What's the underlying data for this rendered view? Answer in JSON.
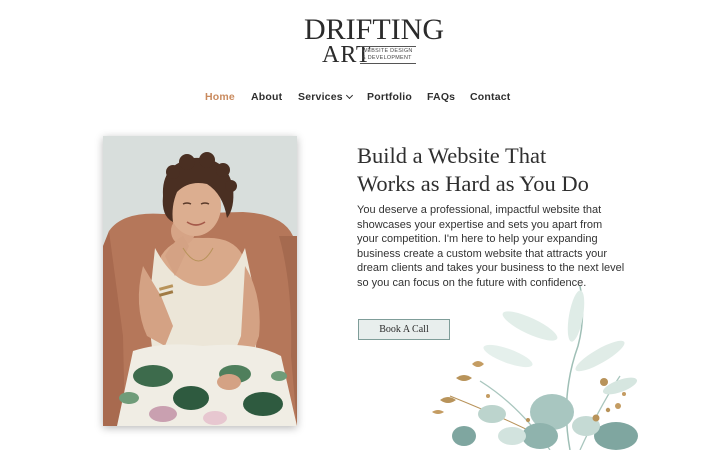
{
  "logo": {
    "word1": "DRIFTING",
    "word2": "ART",
    "tagline_line1": "WEBSITE DESIGN",
    "tagline_line2": "& DEVELOPMENT"
  },
  "nav": {
    "items": [
      {
        "label": "Home",
        "active": true
      },
      {
        "label": "About",
        "active": false
      },
      {
        "label": "Services",
        "active": false
      },
      {
        "label": "Portfolio",
        "active": false
      },
      {
        "label": "FAQs",
        "active": false
      },
      {
        "label": "Contact",
        "active": false
      }
    ]
  },
  "hero": {
    "headline_line1": "Build a Website That",
    "headline_line2": "Works as Hard as You Do",
    "body": "You deserve a professional, impactful website that showcases your expertise and sets you apart from your competition. I'm here to help your expanding business create a custom website that attracts your dream clients and takes your business to the next level so you can focus on the future with confidence.",
    "cta_label": "Book A Call"
  },
  "colors": {
    "accent": "#c98a5e",
    "text": "#2f2f2f",
    "button_bg": "#e8eeed",
    "button_border": "#7f9d99",
    "leaf": "#7fa6a0",
    "gold": "#b8935a"
  },
  "icons": {
    "services_dropdown": "chevron-down-icon"
  }
}
